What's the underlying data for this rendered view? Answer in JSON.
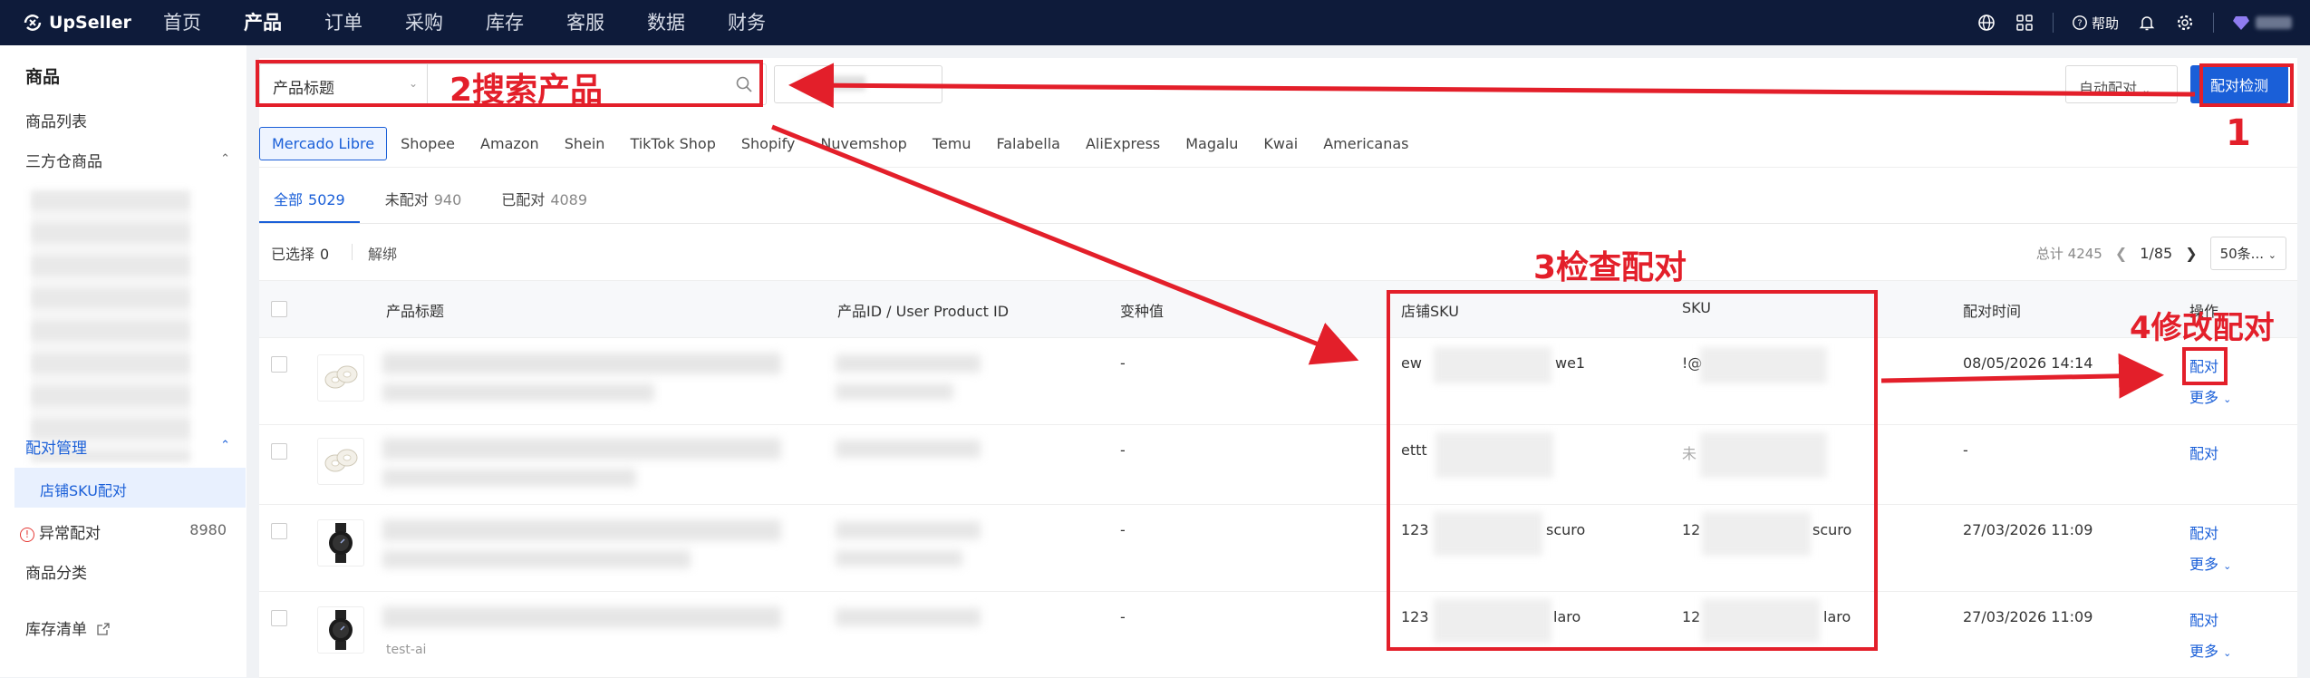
{
  "app": {
    "name": "UpSeller"
  },
  "topnav": [
    "首页",
    "产品",
    "订单",
    "采购",
    "库存",
    "客服",
    "数据",
    "财务"
  ],
  "topnav_active": "产品",
  "topright": {
    "help": "帮助"
  },
  "sidebar": {
    "title": "商品",
    "items": {
      "product_list": "商品列表",
      "third_party_wh": "三方仓商品",
      "match_mgmt": "配对管理",
      "shop_sku_match": "店铺SKU配对",
      "abnormal_match": "异常配对",
      "abnormal_count": "8980",
      "category": "商品分类",
      "inventory_list": "库存清单"
    }
  },
  "toolbar": {
    "search_field": "产品标题",
    "shop_placeholder": "全部店铺",
    "auto_match": "自动配对",
    "detect_button": "配对检测"
  },
  "platforms": [
    "Mercado Libre",
    "Shopee",
    "Amazon",
    "Shein",
    "TikTok Shop",
    "Shopify",
    "Nuvemshop",
    "Temu",
    "Falabella",
    "AliExpress",
    "Magalu",
    "Kwai",
    "Americanas"
  ],
  "platform_active": "Mercado Libre",
  "tabs": [
    {
      "label": "全部",
      "count": "5029"
    },
    {
      "label": "未配对",
      "count": "940"
    },
    {
      "label": "已配对",
      "count": "4089"
    }
  ],
  "selection": {
    "label": "已选择",
    "count": "0",
    "unbind": "解绑"
  },
  "pager": {
    "total": "总计 4245",
    "page": "1/85",
    "size": "50条..."
  },
  "table": {
    "headers": {
      "title": "产品标题",
      "pid": "产品ID / User Product ID",
      "variant": "变种值",
      "shop_sku": "店铺SKU",
      "sku": "SKU",
      "match_time": "配对时间",
      "action": "操作"
    },
    "rows": [
      {
        "variant": "-",
        "shop_sku": "ew",
        "shop_sku_tail": "we1",
        "sku": "!@",
        "sku_tail": "",
        "time": "08/05/2026 14:14",
        "action": "配对",
        "more": "更多"
      },
      {
        "variant": "-",
        "shop_sku": "ettt",
        "shop_sku_tail": "",
        "sku": "未",
        "sku_tail": "",
        "time": "-",
        "action": "配对",
        "more": ""
      },
      {
        "variant": "-",
        "shop_sku": "123",
        "shop_sku_tail": "scuro",
        "sku": "12",
        "sku_tail": "scuro",
        "time": "27/03/2026 11:09",
        "action": "配对",
        "more": "更多"
      },
      {
        "variant": "-",
        "shop_sku": "123",
        "shop_sku_tail": "laro",
        "sku": "12",
        "sku_tail": "laro",
        "time": "27/03/2026 11:09",
        "action": "配对",
        "more": "更多"
      }
    ],
    "partial_caption": "test-ai"
  },
  "annotations": {
    "a1": "1",
    "a2": "2搜索产品",
    "a3": "3检查配对",
    "a4": "4修改配对",
    "color": "#e31f2a"
  },
  "colors": {
    "nav_bg": "#0e1b3a",
    "primary": "#1a5fd8"
  }
}
